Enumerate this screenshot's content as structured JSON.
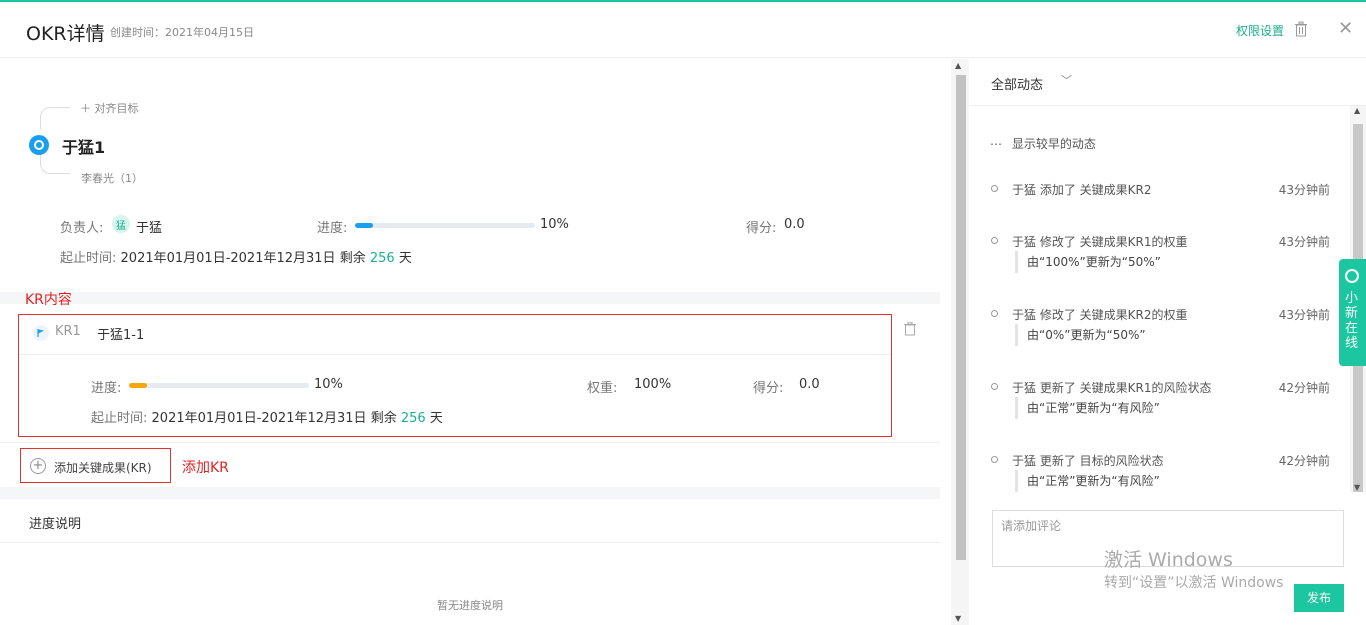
{
  "header": {
    "title": "OKR详情",
    "created": "创建时间：2021年04月15日",
    "permission_label": "权限设置"
  },
  "objective": {
    "align_link": "对齐目标",
    "name": "于猛1",
    "sub_user": "李春光（1）",
    "owner_label": "负责人:",
    "owner_avatar": "猛",
    "owner_name": "于猛",
    "progress_label": "进度:",
    "progress": 10,
    "progress_text": "10%",
    "score_label": "得分:",
    "score": "0.0",
    "period_label": "起止时间:",
    "period": "2021年01月01日-2021年12月31日",
    "remain_prefix": "剩余",
    "remain_days": "256",
    "remain_suffix": "天"
  },
  "annotations": {
    "kr_content": "KR内容",
    "add_kr": "添加KR"
  },
  "key_result": {
    "code": "KR1",
    "name": "于猛1-1",
    "progress_label": "进度:",
    "progress": 10,
    "progress_text": "10%",
    "weight_label": "权重:",
    "weight": "100%",
    "score_label": "得分:",
    "score": "0.0",
    "period_label": "起止时间:",
    "period": "2021年01月01日-2021年12月31日",
    "remain_prefix": "剩余",
    "remain_days": "256",
    "remain_suffix": "天"
  },
  "add_kr_button": "添加关键成果(KR)",
  "progress_desc": {
    "title": "进度说明",
    "empty": "暂无进度说明"
  },
  "activity": {
    "filter": "全部动态",
    "show_earlier": "显示较早的动态",
    "items": [
      {
        "text": "于猛 添加了 关键成果KR2",
        "time": "43分钟前",
        "detail": ""
      },
      {
        "text": "于猛 修改了 关键成果KR1的权重",
        "time": "43分钟前",
        "detail": "由“100%”更新为“50%”"
      },
      {
        "text": "于猛 修改了 关键成果KR2的权重",
        "time": "43分钟前",
        "detail": "由“0%”更新为“50%”"
      },
      {
        "text": "于猛 更新了 关键成果KR1的风险状态",
        "time": "42分钟前",
        "detail": "由“正常”更新为“有风险”"
      },
      {
        "text": "于猛 更新了 目标的风险状态",
        "time": "42分钟前",
        "detail": "由“正常”更新为“有风险”"
      }
    ],
    "comment_placeholder": "请添加评论",
    "publish": "发布"
  },
  "watermark": {
    "line1": "激活 Windows",
    "line2": "转到“设置”以激活 Windows"
  },
  "online_widget": "小新在线",
  "colors": {
    "accent": "#1bc6a0",
    "progress_blue": "#1a9ef0",
    "progress_orange": "#f5a60a",
    "annotation_red": "#e23131"
  }
}
